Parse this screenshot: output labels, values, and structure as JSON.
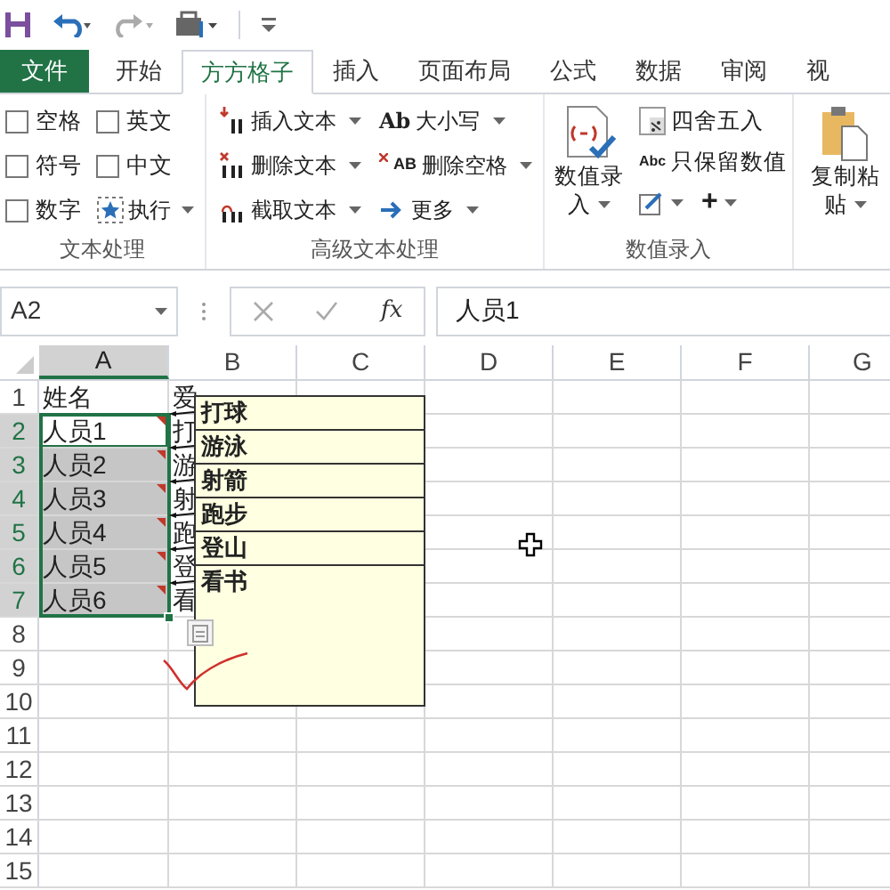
{
  "tabs": [
    {
      "label": "文件",
      "kind": "file",
      "selected": false
    },
    {
      "label": "开始",
      "kind": "tab",
      "selected": false
    },
    {
      "label": "方方格子",
      "kind": "tab",
      "selected": true
    },
    {
      "label": "插入",
      "kind": "tab",
      "selected": false
    },
    {
      "label": "页面布局",
      "kind": "tab",
      "selected": false
    },
    {
      "label": "公式",
      "kind": "tab",
      "selected": false
    },
    {
      "label": "数据",
      "kind": "tab",
      "selected": false
    },
    {
      "label": "审阅",
      "kind": "tab",
      "selected": false
    },
    {
      "label": "视",
      "kind": "tab",
      "selected": false
    }
  ],
  "text_group": {
    "label": "文本处理",
    "checkboxes": [
      {
        "label": "空格",
        "checked": false
      },
      {
        "label": "符号",
        "checked": false
      },
      {
        "label": "数字",
        "checked": false
      },
      {
        "label": "英文",
        "checked": false
      },
      {
        "label": "中文",
        "checked": false
      }
    ],
    "execute_button": {
      "label": "执行"
    }
  },
  "advanced_group": {
    "label": "高级文本处理",
    "buttons": [
      {
        "label": "插入文本",
        "kind": "insert"
      },
      {
        "label": "删除文本",
        "kind": "delete"
      },
      {
        "label": "截取文本",
        "kind": "extract"
      },
      {
        "label": "大小写",
        "kind": "case",
        "icon_text": "Ab"
      },
      {
        "label": "删除空格",
        "kind": "space",
        "icon_text": "AB"
      },
      {
        "label": "更多",
        "kind": "more"
      }
    ]
  },
  "number_group": {
    "label": "数值录入",
    "big_button": {
      "label_lines": [
        "数值录",
        "入"
      ]
    },
    "buttons": [
      {
        "label": "四舍五入",
        "kind": "round"
      },
      {
        "label": "只保留数值",
        "kind": "keep",
        "icon_text": "Abc"
      }
    ],
    "tool_buttons": [
      {
        "kind": "edit"
      },
      {
        "kind": "plus",
        "label": "+"
      }
    ]
  },
  "paste_group": {
    "label_lines": [
      "复制粘",
      "贴"
    ]
  },
  "formula_bar": {
    "name_box": "A2",
    "function_label": "fx",
    "formula": "人员1"
  },
  "columns": [
    {
      "label": "A",
      "selected": true
    },
    {
      "label": "B",
      "selected": false
    },
    {
      "label": "C",
      "selected": false
    },
    {
      "label": "D",
      "selected": false
    },
    {
      "label": "E",
      "selected": false
    },
    {
      "label": "F",
      "selected": false
    },
    {
      "label": "G",
      "selected": false
    }
  ],
  "rows": [
    {
      "label": "1",
      "selected": false,
      "active": false,
      "cells": [
        "姓名",
        "爱"
      ]
    },
    {
      "label": "2",
      "selected": true,
      "active": true,
      "cells": [
        "人员1",
        "打"
      ],
      "comment": "打球"
    },
    {
      "label": "3",
      "selected": true,
      "active": false,
      "cells": [
        "人员2",
        "游"
      ],
      "comment": "游泳"
    },
    {
      "label": "4",
      "selected": true,
      "active": false,
      "cells": [
        "人员3",
        "射"
      ],
      "comment": "射箭"
    },
    {
      "label": "5",
      "selected": true,
      "active": false,
      "cells": [
        "人员4",
        "跑"
      ],
      "comment": "跑步"
    },
    {
      "label": "6",
      "selected": true,
      "active": false,
      "cells": [
        "人员5",
        "登"
      ],
      "comment": "登山"
    },
    {
      "label": "7",
      "selected": true,
      "active": false,
      "cells": [
        "人员6",
        "看"
      ],
      "comment": "看书"
    },
    {
      "label": "8",
      "selected": false,
      "active": false,
      "cells": []
    },
    {
      "label": "9",
      "selected": false,
      "active": false,
      "cells": []
    },
    {
      "label": "10",
      "selected": false,
      "active": false,
      "cells": []
    },
    {
      "label": "11",
      "selected": false,
      "active": false,
      "cells": []
    },
    {
      "label": "12",
      "selected": false,
      "active": false,
      "cells": []
    },
    {
      "label": "13",
      "selected": false,
      "active": false,
      "cells": []
    },
    {
      "label": "14",
      "selected": false,
      "active": false,
      "cells": []
    },
    {
      "label": "15",
      "selected": false,
      "active": false,
      "cells": []
    }
  ]
}
